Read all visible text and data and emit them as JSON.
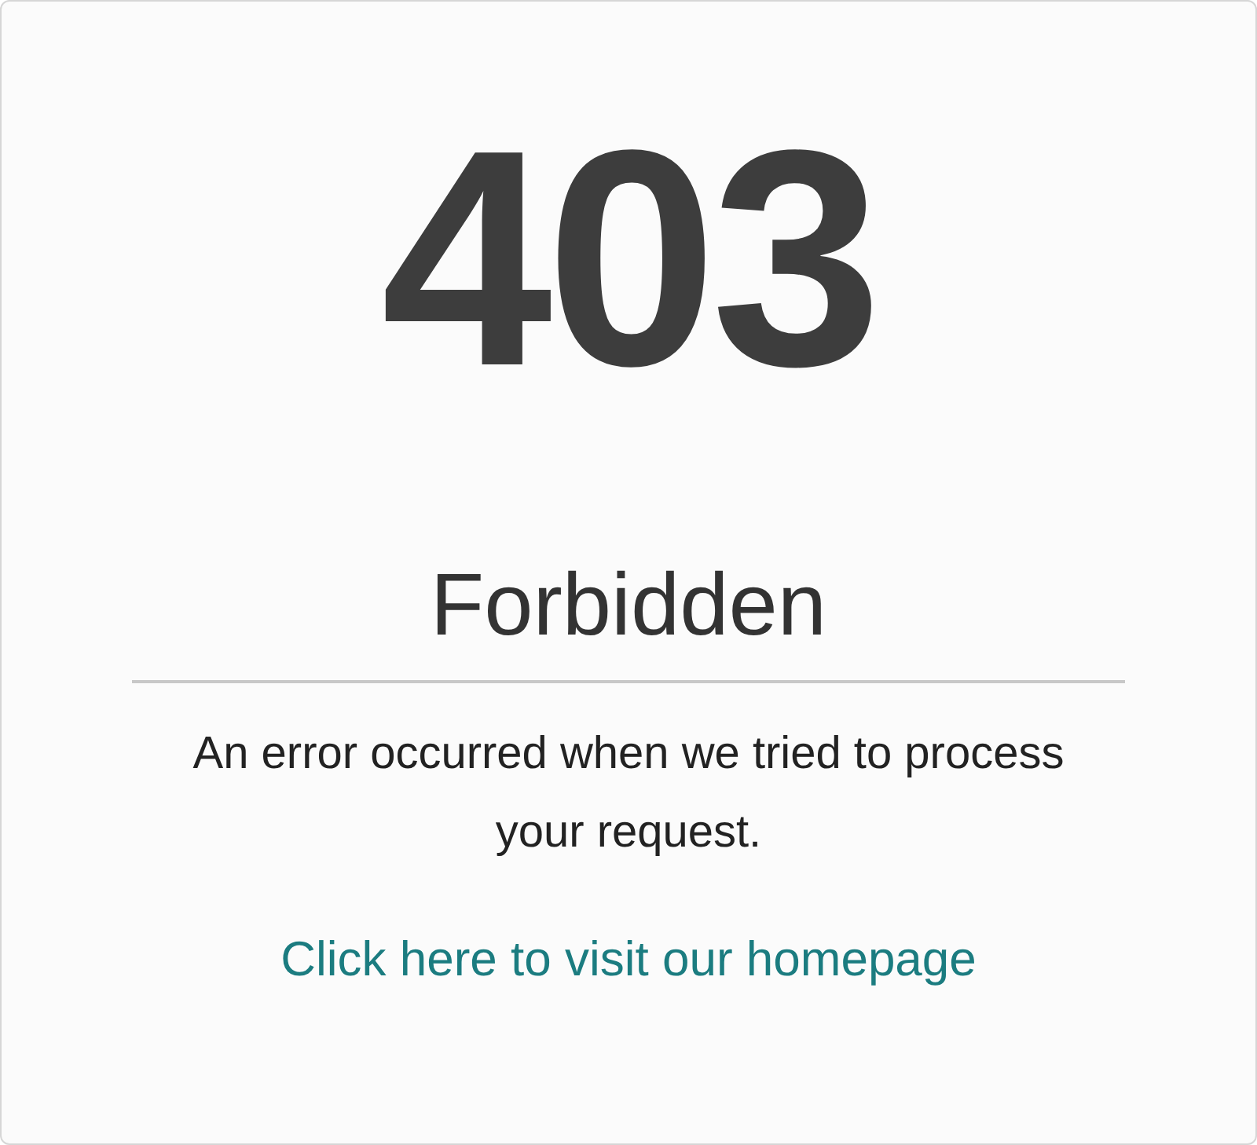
{
  "code": "403",
  "title": "Forbidden",
  "message": "An error occurred when we tried to process your request.",
  "link": "Click here to visit our homepage"
}
